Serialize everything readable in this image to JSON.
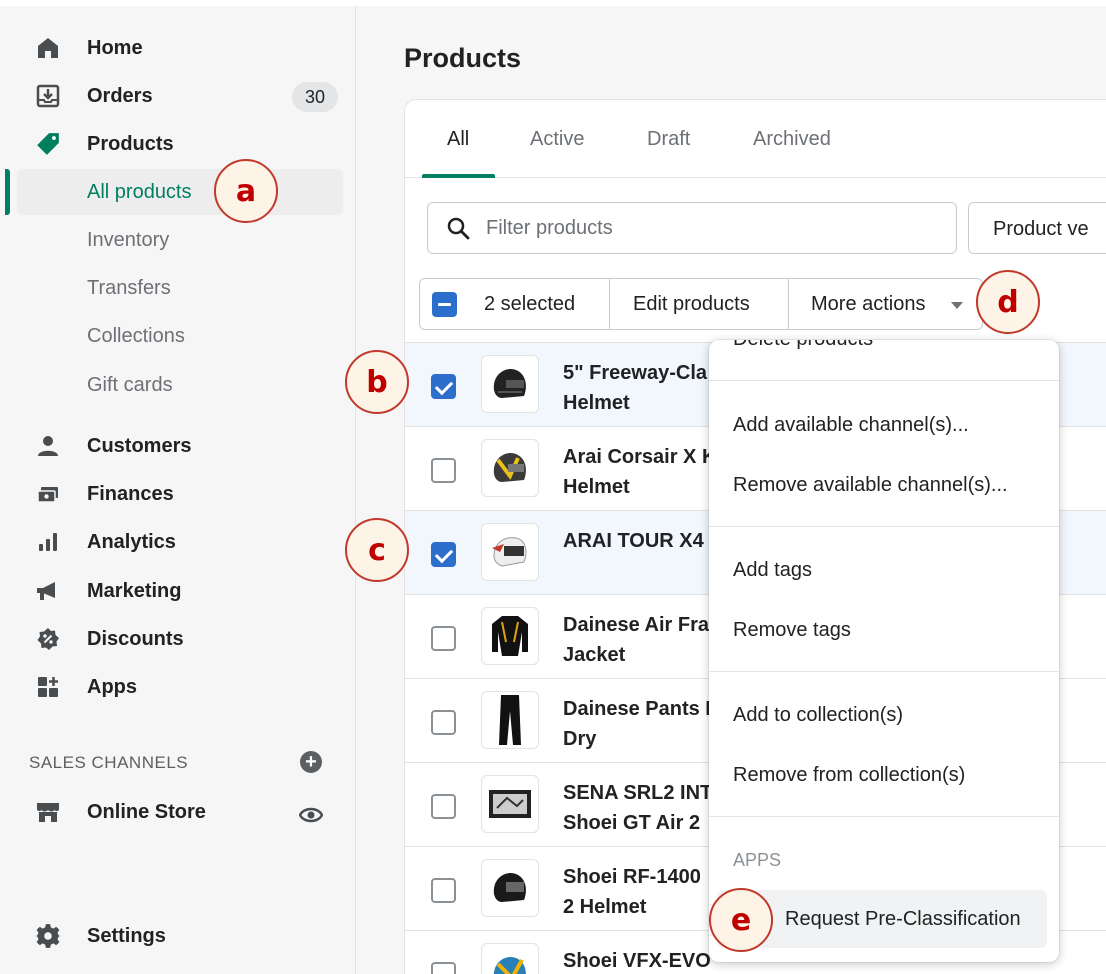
{
  "sidebar": {
    "nav": [
      {
        "label": "Home",
        "icon": "home-icon"
      },
      {
        "label": "Orders",
        "icon": "orders-icon",
        "badge": "30"
      },
      {
        "label": "Products",
        "icon": "tag-icon"
      }
    ],
    "product_sub": [
      {
        "label": "All products",
        "active": true
      },
      {
        "label": "Inventory"
      },
      {
        "label": "Transfers"
      },
      {
        "label": "Collections"
      },
      {
        "label": "Gift cards"
      }
    ],
    "nav2": [
      {
        "label": "Customers",
        "icon": "customer-icon"
      },
      {
        "label": "Finances",
        "icon": "finances-icon"
      },
      {
        "label": "Analytics",
        "icon": "analytics-icon"
      },
      {
        "label": "Marketing",
        "icon": "megaphone-icon"
      },
      {
        "label": "Discounts",
        "icon": "discount-icon"
      },
      {
        "label": "Apps",
        "icon": "apps-icon"
      }
    ],
    "sales_channels_heading": "SALES CHANNELS",
    "online_store": "Online Store",
    "settings": "Settings"
  },
  "main": {
    "title": "Products",
    "tabs": [
      "All",
      "Active",
      "Draft",
      "Archived"
    ],
    "filter_placeholder": "Filter products",
    "product_vendor_button": "Product ve",
    "bulk": {
      "selected": "2 selected",
      "edit": "Edit products",
      "more": "More actions"
    },
    "products": [
      {
        "line1": "5\" Freeway-Cla",
        "line2": "Helmet",
        "selected": true
      },
      {
        "line1": "Arai Corsair X K",
        "line2": "Helmet",
        "selected": false
      },
      {
        "line1": "ARAI TOUR X4",
        "line2": "",
        "selected": true
      },
      {
        "line1": "Dainese Air Fra",
        "line2": "Jacket",
        "selected": false
      },
      {
        "line1": "Dainese Pants I",
        "line2": "Dry",
        "selected": false
      },
      {
        "line1": "SENA SRL2 INT",
        "line2": "Shoei GT Air 2",
        "selected": false
      },
      {
        "line1": "Shoei RF-1400",
        "line2": "2 Helmet",
        "selected": false
      },
      {
        "line1": "Shoei VFX-EVO",
        "line2": "",
        "selected": false
      }
    ]
  },
  "menu": {
    "delete": "Delete products",
    "add_channel": "Add available channel(s)...",
    "remove_channel": "Remove available channel(s)...",
    "add_tags": "Add tags",
    "remove_tags": "Remove tags",
    "add_collection": "Add to collection(s)",
    "remove_collection": "Remove from collection(s)",
    "apps_heading": "APPS",
    "pre_classification": "Request Pre-Classification"
  },
  "annotations": {
    "a": "a",
    "b": "b",
    "c": "c",
    "d": "d",
    "e": "e"
  },
  "colors": {
    "accent": "#008060",
    "checkbox": "#2c6ecb",
    "annotation": "#c00000"
  }
}
